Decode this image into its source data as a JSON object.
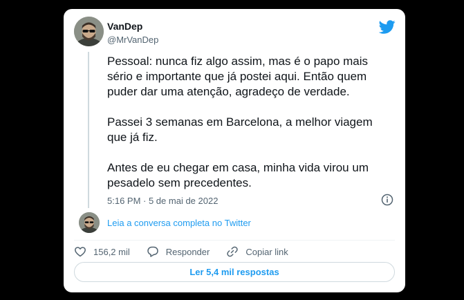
{
  "tweet": {
    "display_name": "VanDep",
    "handle": "@MrVanDep",
    "paragraphs": [
      "Pessoal: nunca fiz algo assim, mas é o papo mais sério e importante que já postei aqui. Então quem puder dar uma atenção, agradeço de verdade.",
      "Passei 3 semanas em Barcelona, a melhor viagem que já fiz.",
      "Antes de eu chegar em casa, minha vida virou um pesadelo sem precedentes."
    ],
    "timestamp": "5:16 PM · 5 de mai de 2022"
  },
  "conversation_link": "Leia a conversa completa no Twitter",
  "actions": {
    "like_count": "156,2 mil",
    "reply_label": "Responder",
    "copy_link_label": "Copiar link"
  },
  "replies_button": "Ler 5,4 mil respostas",
  "colors": {
    "accent": "#1d9bf0",
    "text": "#0f1419",
    "secondary": "#536471",
    "background": "#000000",
    "card": "#ffffff"
  }
}
